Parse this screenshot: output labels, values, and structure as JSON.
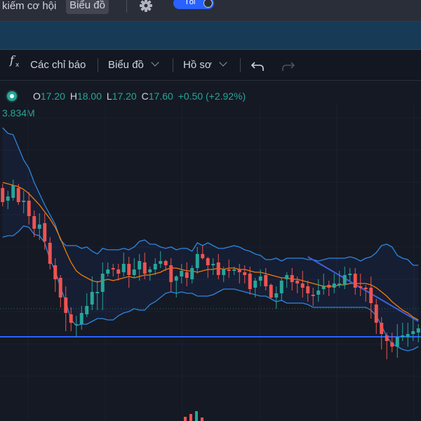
{
  "topbar": {
    "opportunity_link": "kiếm cơ hội",
    "chart_button": "Biểu đồ",
    "theme_toggle": "Tối"
  },
  "toolbar": {
    "indicators": "Các chỉ báo",
    "charts": "Biểu đồ",
    "profile": "Hồ sơ"
  },
  "legend": {
    "open_key": "O",
    "open": "17.20",
    "high_key": "H",
    "high": "18.00",
    "low_key": "L",
    "low": "17.20",
    "close_key": "C",
    "close": "17.60",
    "change": "+0.50 (+2.92%)"
  },
  "volume": "3.834M",
  "colors": {
    "up": "#26a69a",
    "down": "#ef5350",
    "bollinger": "#2e86de",
    "ma": "#f57c00",
    "support_line": "#2962ff",
    "trend_line": "#3f5fd8",
    "accent": "#2962ff"
  },
  "chart_data": {
    "type": "candlestick",
    "title": "",
    "indicators": [
      "Bollinger Bands",
      "Moving Average"
    ],
    "candles": [
      [
        17.95,
        17.85,
        17.98,
        17.82
      ],
      [
        17.86,
        17.89,
        17.93,
        17.8
      ],
      [
        17.88,
        17.97,
        18.01,
        17.86
      ],
      [
        17.95,
        17.85,
        17.98,
        17.83
      ],
      [
        17.85,
        17.86,
        17.93,
        17.77
      ],
      [
        17.86,
        17.75,
        17.92,
        17.69
      ],
      [
        17.75,
        17.66,
        17.79,
        17.6
      ],
      [
        17.66,
        17.69,
        17.77,
        17.58
      ],
      [
        17.7,
        17.57,
        17.77,
        17.51
      ],
      [
        17.56,
        17.41,
        17.6,
        17.37
      ],
      [
        17.4,
        17.3,
        17.45,
        17.21
      ],
      [
        17.31,
        17.17,
        17.33,
        17.1
      ],
      [
        17.17,
        17.06,
        17.25,
        16.93
      ],
      [
        17.05,
        16.99,
        17.1,
        16.93
      ],
      [
        16.98,
        16.98,
        17.04,
        16.89
      ],
      [
        16.98,
        17.06,
        17.11,
        16.94
      ],
      [
        17.05,
        17.11,
        17.2,
        17.03
      ],
      [
        17.12,
        17.21,
        17.32,
        17.08
      ],
      [
        17.2,
        17.21,
        17.29,
        17.08
      ],
      [
        17.21,
        17.34,
        17.42,
        17.08
      ],
      [
        17.34,
        17.37,
        17.42,
        17.32
      ],
      [
        17.38,
        17.37,
        17.41,
        17.32
      ],
      [
        17.37,
        17.34,
        17.41,
        17.29
      ],
      [
        17.35,
        17.41,
        17.49,
        17.32
      ],
      [
        17.41,
        17.33,
        17.46,
        17.24
      ],
      [
        17.33,
        17.37,
        17.45,
        17.31
      ],
      [
        17.37,
        17.43,
        17.48,
        17.29
      ],
      [
        17.42,
        17.34,
        17.49,
        17.3
      ],
      [
        17.35,
        17.37,
        17.39,
        17.29
      ],
      [
        17.37,
        17.41,
        17.45,
        17.33
      ],
      [
        17.41,
        17.43,
        17.5,
        17.38
      ],
      [
        17.43,
        17.4,
        17.44,
        17.36
      ],
      [
        17.4,
        17.28,
        17.45,
        17.21
      ],
      [
        17.29,
        17.32,
        17.33,
        17.17
      ],
      [
        17.32,
        17.36,
        17.41,
        17.27
      ],
      [
        17.35,
        17.31,
        17.42,
        17.25
      ],
      [
        17.3,
        17.38,
        17.4,
        17.27
      ],
      [
        17.38,
        17.48,
        17.53,
        17.34
      ],
      [
        17.48,
        17.45,
        17.54,
        17.44
      ],
      [
        17.45,
        17.4,
        17.46,
        17.31
      ],
      [
        17.4,
        17.41,
        17.45,
        17.33
      ],
      [
        17.42,
        17.33,
        17.48,
        17.3
      ],
      [
        17.33,
        17.37,
        17.39,
        17.28
      ],
      [
        17.37,
        17.36,
        17.44,
        17.31
      ],
      [
        17.36,
        17.37,
        17.39,
        17.33
      ],
      [
        17.37,
        17.35,
        17.41,
        17.27
      ],
      [
        17.35,
        17.33,
        17.4,
        17.27
      ],
      [
        17.34,
        17.23,
        17.39,
        17.19
      ],
      [
        17.24,
        17.29,
        17.31,
        17.17
      ],
      [
        17.29,
        17.32,
        17.37,
        17.25
      ],
      [
        17.33,
        17.25,
        17.38,
        17.22
      ],
      [
        17.26,
        17.17,
        17.27,
        17.16
      ],
      [
        17.17,
        17.2,
        17.25,
        17.09
      ],
      [
        17.2,
        17.29,
        17.31,
        17.15
      ],
      [
        17.3,
        17.33,
        17.35,
        17.24
      ],
      [
        17.33,
        17.28,
        17.38,
        17.22
      ],
      [
        17.29,
        17.27,
        17.32,
        17.2
      ],
      [
        17.27,
        17.24,
        17.36,
        17.17
      ],
      [
        17.25,
        17.2,
        17.29,
        17.14
      ],
      [
        17.19,
        17.18,
        17.24,
        17.11
      ],
      [
        17.19,
        17.22,
        17.3,
        17.14
      ],
      [
        17.23,
        17.25,
        17.34,
        17.19
      ],
      [
        17.26,
        17.24,
        17.29,
        17.18
      ],
      [
        17.24,
        17.27,
        17.34,
        17.2
      ],
      [
        17.26,
        17.27,
        17.36,
        17.24
      ],
      [
        17.26,
        17.33,
        17.39,
        17.23
      ],
      [
        17.33,
        17.34,
        17.38,
        17.29
      ],
      [
        17.34,
        17.24,
        17.38,
        17.19
      ],
      [
        17.25,
        17.24,
        17.34,
        17.18
      ],
      [
        17.24,
        17.23,
        17.26,
        17.14
      ],
      [
        17.24,
        17.13,
        17.32,
        17.02
      ],
      [
        17.12,
        16.99,
        17.16,
        16.91
      ],
      [
        16.99,
        16.91,
        17.03,
        16.8
      ],
      [
        16.9,
        16.86,
        16.92,
        16.73
      ],
      [
        16.85,
        16.82,
        16.92,
        16.78
      ],
      [
        16.82,
        16.89,
        16.98,
        16.74
      ],
      [
        16.89,
        16.9,
        16.99,
        16.86
      ],
      [
        16.89,
        16.91,
        16.99,
        16.82
      ],
      [
        16.91,
        16.93,
        17.03,
        16.86
      ],
      [
        16.92,
        16.95,
        16.98,
        16.85
      ]
    ],
    "bollinger": {
      "upper": [
        18.38,
        18.34,
        18.33,
        18.24,
        18.15,
        18.09,
        17.99,
        17.91,
        17.83,
        17.76,
        17.69,
        17.58,
        17.54,
        17.54,
        17.54,
        17.52,
        17.53,
        17.5,
        17.48,
        17.52,
        17.51,
        17.51,
        17.51,
        17.52,
        17.51,
        17.53,
        17.57,
        17.58,
        17.55,
        17.55,
        17.53,
        17.52,
        17.53,
        17.51,
        17.52,
        17.52,
        17.5,
        17.56,
        17.54,
        17.56,
        17.54,
        17.52,
        17.52,
        17.53,
        17.54,
        17.53,
        17.51,
        17.5,
        17.48,
        17.47,
        17.44,
        17.44,
        17.45,
        17.43,
        17.45,
        17.45,
        17.45,
        17.45,
        17.44,
        17.44,
        17.43,
        17.44,
        17.45,
        17.45,
        17.45,
        17.45,
        17.46,
        17.45,
        17.43,
        17.45,
        17.46,
        17.49,
        17.54,
        17.55,
        17.53,
        17.47,
        17.45,
        17.44,
        17.4,
        17.4
      ],
      "middle": [
        17.99,
        17.98,
        17.97,
        17.96,
        17.94,
        17.91,
        17.87,
        17.83,
        17.78,
        17.73,
        17.67,
        17.59,
        17.5,
        17.42,
        17.36,
        17.33,
        17.31,
        17.29,
        17.28,
        17.29,
        17.3,
        17.29,
        17.3,
        17.31,
        17.32,
        17.31,
        17.32,
        17.33,
        17.33,
        17.34,
        17.35,
        17.37,
        17.38,
        17.38,
        17.37,
        17.36,
        17.36,
        17.35,
        17.36,
        17.37,
        17.37,
        17.38,
        17.37,
        17.38,
        17.38,
        17.37,
        17.37,
        17.36,
        17.35,
        17.35,
        17.34,
        17.33,
        17.32,
        17.31,
        17.31,
        17.3,
        17.3,
        17.29,
        17.28,
        17.27,
        17.26,
        17.25,
        17.25,
        17.25,
        17.26,
        17.26,
        17.27,
        17.27,
        17.27,
        17.27,
        17.26,
        17.24,
        17.21,
        17.18,
        17.14,
        17.11,
        17.08,
        17.06,
        17.03,
        17.01
      ],
      "lower": [
        17.6,
        17.61,
        17.61,
        17.64,
        17.68,
        17.67,
        17.62,
        17.61,
        17.56,
        17.44,
        17.36,
        17.24,
        17.14,
        17.01,
        16.97,
        16.98,
        16.98,
        17.0,
        17.02,
        17.02,
        17.01,
        17.01,
        17.04,
        17.06,
        17.07,
        17.09,
        17.08,
        17.08,
        17.12,
        17.14,
        17.17,
        17.2,
        17.21,
        17.2,
        17.21,
        17.2,
        17.2,
        17.18,
        17.18,
        17.18,
        17.19,
        17.21,
        17.23,
        17.23,
        17.23,
        17.22,
        17.21,
        17.2,
        17.19,
        17.18,
        17.18,
        17.16,
        17.14,
        17.15,
        17.13,
        17.13,
        17.13,
        17.13,
        17.12,
        17.1,
        17.1,
        17.1,
        17.1,
        17.1,
        17.1,
        17.1,
        17.1,
        17.1,
        17.1,
        17.1,
        17.08,
        17.04,
        16.97,
        16.89,
        16.84,
        16.82,
        16.8,
        16.79,
        16.8,
        16.82
      ]
    },
    "support_level": 16.89,
    "reference_level": 17.09,
    "trend_line": [
      [
        58,
        17.46
      ],
      [
        79,
        17.0
      ]
    ],
    "volume_last": "3.834M"
  }
}
